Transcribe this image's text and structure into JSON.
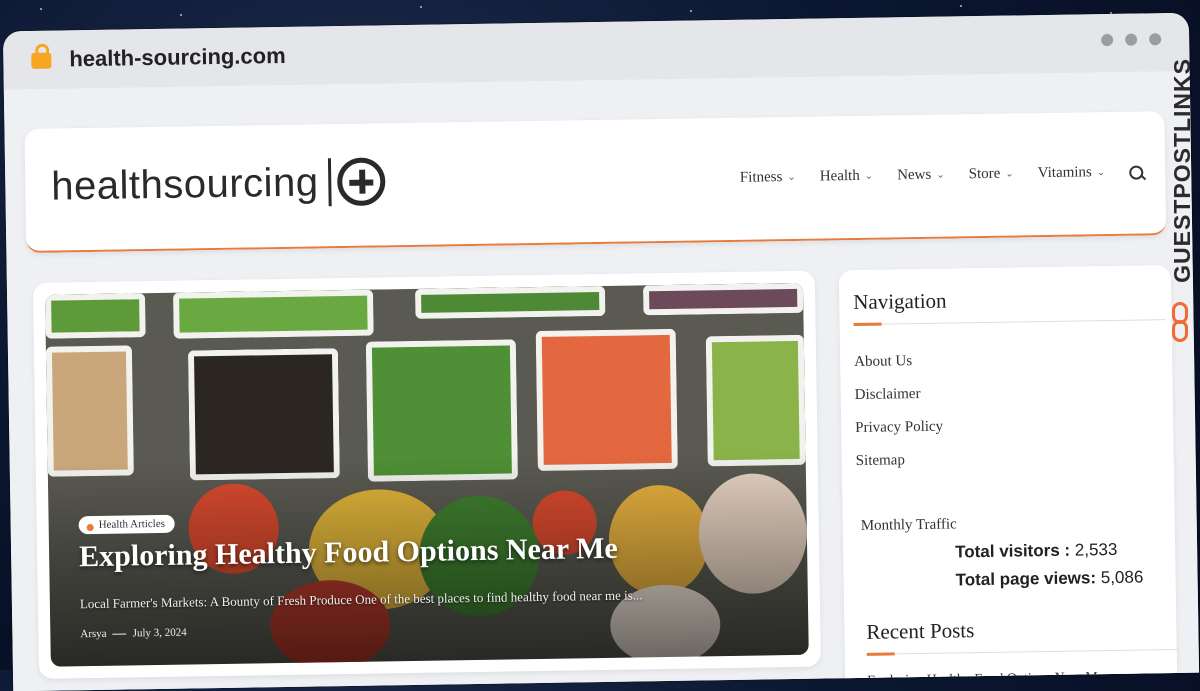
{
  "browser": {
    "url": "health-sourcing.com"
  },
  "site": {
    "logo_text": "healthsourcing",
    "nav": [
      {
        "label": "Fitness"
      },
      {
        "label": "Health"
      },
      {
        "label": "News"
      },
      {
        "label": "Store"
      },
      {
        "label": "Vitamins"
      }
    ]
  },
  "hero": {
    "category": "Health Articles",
    "title": "Exploring Healthy Food Options Near Me",
    "excerpt": "Local Farmer's Markets: A Bounty of Fresh Produce One of the best places to find healthy food near me is...",
    "author": "Arsya",
    "date": "July 3, 2024"
  },
  "sidebar": {
    "navigation_title": "Navigation",
    "links": [
      {
        "label": "About Us"
      },
      {
        "label": "Disclaimer"
      },
      {
        "label": "Privacy Policy"
      },
      {
        "label": "Sitemap"
      }
    ],
    "traffic_label": "Monthly Traffic",
    "total_visitors_label": "Total visitors :",
    "total_visitors": "2,533",
    "total_pageviews_label": "Total page views:",
    "total_pageviews": "5,086",
    "recent_title": "Recent Posts",
    "recent": [
      {
        "label": "Exploring Healthy Food Options Near Me"
      }
    ]
  },
  "brand": {
    "watermark": "GUESTPOSTLINKS"
  },
  "colors": {
    "accent": "#e87a3a",
    "brand_orange": "#f06a33"
  }
}
